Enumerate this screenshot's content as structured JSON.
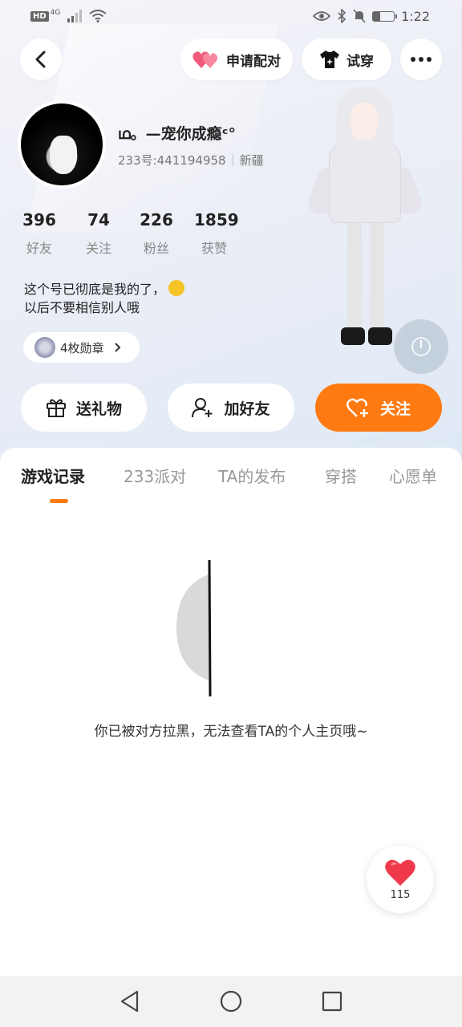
{
  "status_bar": {
    "network_badge": "HD",
    "network_type": "4G",
    "time": "1:22",
    "battery_level": 0.35
  },
  "header": {
    "match_label": "申请配对",
    "tryon_label": "试穿"
  },
  "profile": {
    "nickname": "ഥ。—宠你成瘾ᶜ°",
    "uid": "233号:441194958",
    "location": "新疆",
    "stats": [
      {
        "value": "396",
        "label": "好友"
      },
      {
        "value": "74",
        "label": "关注"
      },
      {
        "value": "226",
        "label": "粉丝"
      },
      {
        "value": "1859",
        "label": "获赞"
      }
    ],
    "bio_line1": "这个号已彻底是我的了，",
    "bio_line2": "以后不要相信别人哦",
    "badge_label": "4枚勋章"
  },
  "actions": {
    "gift_label": "送礼物",
    "add_friend_label": "加好友",
    "follow_label": "关注"
  },
  "tabs": [
    {
      "label": "游戏记录",
      "active": true
    },
    {
      "label": "233派对",
      "active": false
    },
    {
      "label": "TA的发布",
      "active": false
    },
    {
      "label": "穿搭",
      "active": false
    },
    {
      "label": "心愿单",
      "active": false
    }
  ],
  "empty_state": {
    "message": "你已被对方拉黑，无法查看TA的个人主页哦~"
  },
  "like": {
    "count": "115"
  },
  "colors": {
    "accent": "#ff7a10",
    "like_red": "#f03a4b",
    "match_pink": "#f15a7a"
  }
}
